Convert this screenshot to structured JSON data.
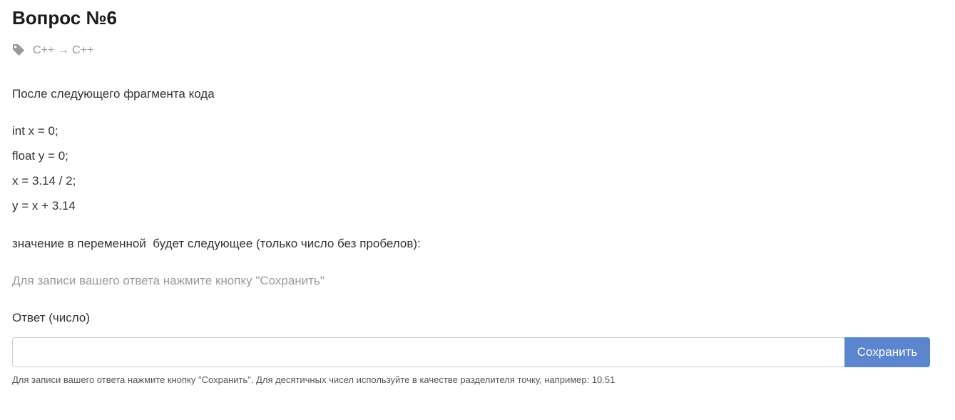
{
  "question": {
    "title": "Вопрос №6",
    "tags": "C++ → C++"
  },
  "body": {
    "intro": "После следующего фрагмента кода",
    "code_lines": [
      "int x = 0;",
      "float y = 0;",
      "x = 3.14 / 2;",
      "y = x + 3.14"
    ],
    "prompt": "значение в переменной  будет следующее (только число без пробелов):",
    "hint": "Для записи вашего ответа нажмите кнопку \"Сохранить\""
  },
  "answer": {
    "label": "Ответ (число)",
    "value": "",
    "placeholder": "",
    "save_label": "Сохранить",
    "footnote": "Для записи вашего ответа нажмите кнопку \"Сохранить\". Для десятичных чисел используйте в качестве разделителя точку, например: 10.51"
  },
  "icons": {
    "tag": "tag-icon"
  },
  "colors": {
    "accent": "#5b86cf",
    "muted": "#9a9a9a",
    "text": "#333333"
  }
}
